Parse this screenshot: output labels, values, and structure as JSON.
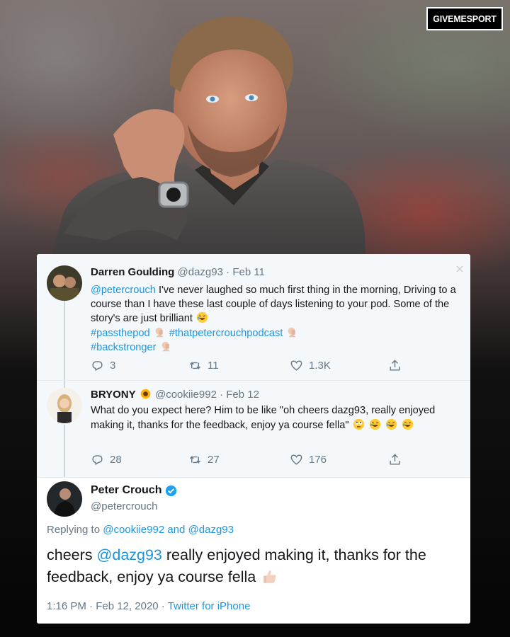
{
  "brand": {
    "badge": "GIVEMESPORT"
  },
  "tweets": [
    {
      "name": "Darren Goulding",
      "handle": "@dazg93",
      "date": "Feb 11",
      "body_mention": "@petercrouch",
      "body_text": "I've never laughed so much first thing in the morning, Driving to a course than I have these last couple of days listening to your pod. Some of the story's are just brilliant",
      "hashtags": [
        "#passthepod",
        "#thatpetercrouchpodcast",
        "#backstronger"
      ],
      "stats": {
        "replies": "3",
        "retweets": "11",
        "likes": "1.3K"
      }
    },
    {
      "name": "BRYONY",
      "handle": "@cookiie992",
      "date": "Feb 12",
      "body_text": "What do you expect here? Him to be like \"oh cheers dazg93, really enjoyed making it, thanks for the feedback, enjoy ya course fella\"",
      "stats": {
        "replies": "28",
        "retweets": "27",
        "likes": "176"
      }
    }
  ],
  "main_tweet": {
    "name": "Peter Crouch",
    "handle": "@petercrouch",
    "replying_prefix": "Replying to",
    "replying_to_1": "@cookiie992",
    "replying_and": "and",
    "replying_to_2": "@dazg93",
    "text_start": "cheers",
    "text_mention": "@dazg93",
    "text_rest": "really enjoyed making it, thanks for the feedback, enjoy ya course fella",
    "time": "1:16 PM",
    "date": "Feb 12, 2020",
    "source": "Twitter for iPhone"
  },
  "separator_dot": "·",
  "icons": {
    "reply": "reply-icon",
    "retweet": "retweet-icon",
    "like": "heart-icon",
    "share": "share-icon",
    "verified": "verified-badge-icon",
    "laughing": "rolling-laughing-emoji",
    "facepalm": "person-facepalming-emoji",
    "eyeroll": "eye-roll-emoji",
    "sunflower": "sunflower-emoji",
    "thumbs": "thumbs-up-emoji"
  },
  "colors": {
    "link": "#1b95e0",
    "muted": "#657786",
    "verified": "#1da1f2",
    "card_bg": "#ffffff",
    "thread_bg": "#f5f8fa"
  }
}
